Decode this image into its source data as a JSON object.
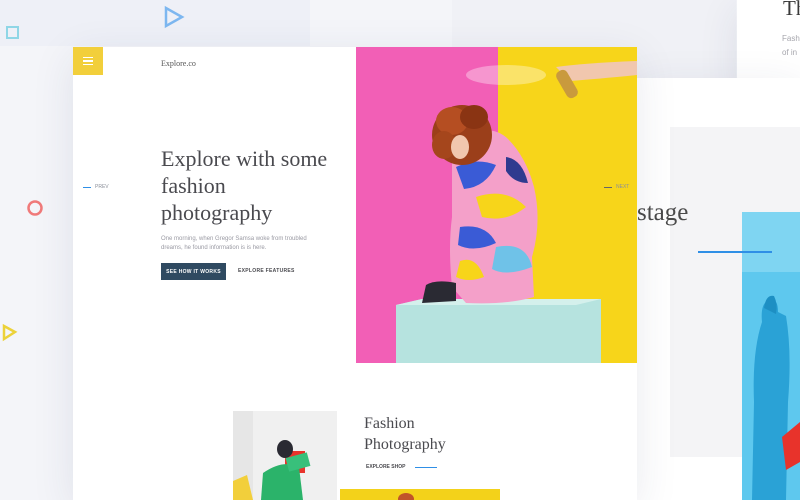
{
  "brand": {
    "logo": "Explore.co"
  },
  "hero": {
    "headline": "Explore with some fashion photography",
    "description": "One morning, when Gregor Samsa woke from troubled dreams, he found information is is here.",
    "primary_cta": "SEE HOW IT WORKS",
    "secondary_cta": "EXPLORE FEATURES"
  },
  "nav": {
    "prev": "PREV",
    "next": "NEXT"
  },
  "section": {
    "title": "Fashion Photography",
    "link": "EXPLORE SHOP"
  },
  "side_card": {
    "word": "stage"
  },
  "top_right_card": {
    "title": "Th",
    "line1": "Fash",
    "line2": "of in"
  },
  "colors": {
    "accent_yellow": "#f2cf3b",
    "primary_dark": "#2f4a61",
    "link_blue": "#2f8fe6",
    "hero_pink": "#f25fb6",
    "hero_yellow": "#f7d51a"
  }
}
